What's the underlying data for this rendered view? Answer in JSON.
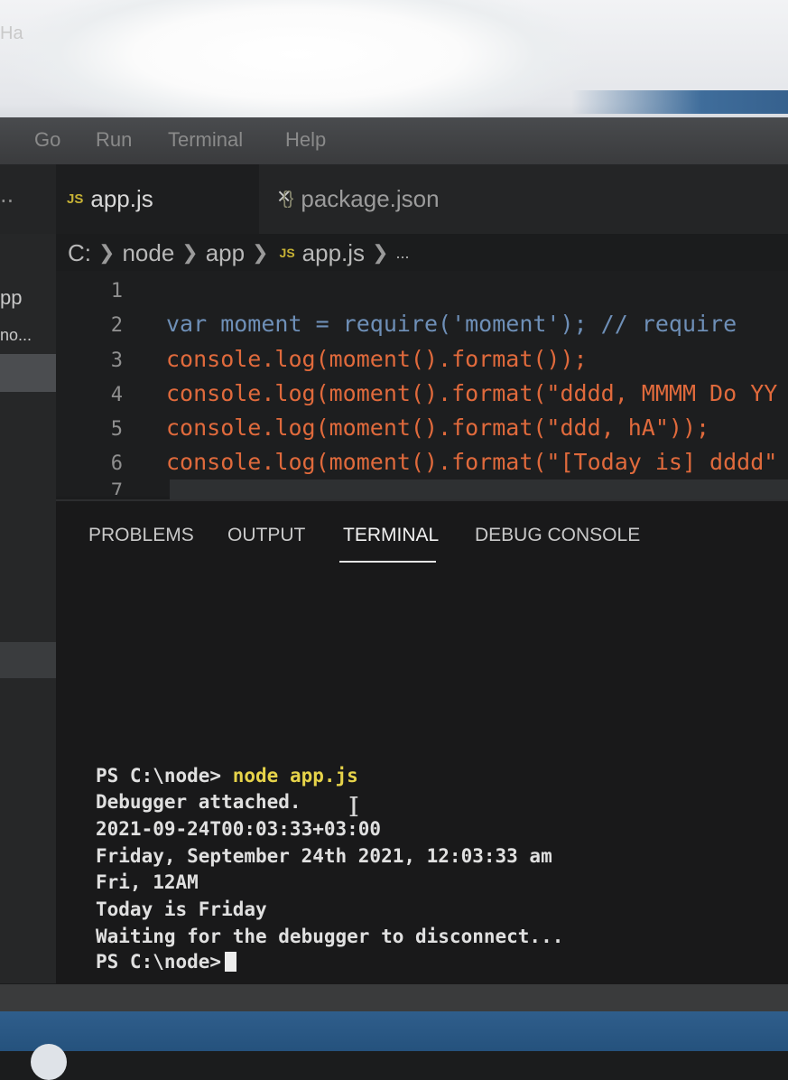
{
  "window": {
    "title_fragment": "Ha"
  },
  "menu": {
    "items": [
      "Go",
      "Run",
      "Terminal",
      "Help"
    ]
  },
  "tabs": [
    {
      "badge": "JS",
      "label": "app.js",
      "close": "×"
    },
    {
      "icon": "{}",
      "label": "package.json"
    }
  ],
  "tab_overflow": "..",
  "breadcrumb": {
    "drive": "C:",
    "parts": [
      "node",
      "app"
    ],
    "file_badge": "JS",
    "file": "app.js",
    "more": "..."
  },
  "sidebar": {
    "item1": "pp",
    "item2": "no..."
  },
  "editor": {
    "line_numbers": [
      "1",
      "2",
      "3",
      "4",
      "5",
      "6",
      "7"
    ],
    "lines": [
      "",
      "var moment = require('moment'); // require",
      "console.log(moment().format());",
      "console.log(moment().format(\"dddd, MMMM Do YY",
      "console.log(moment().format(\"ddd, hA\"));",
      "console.log(moment().format(\"[Today is] dddd\""
    ]
  },
  "panel": {
    "tabs": [
      "PROBLEMS",
      "OUTPUT",
      "TERMINAL",
      "DEBUG CONSOLE"
    ],
    "active_tab": "TERMINAL"
  },
  "terminal": {
    "prompt": "PS C:\\node>",
    "command": "node app.js",
    "output": [
      "Debugger attached.",
      "2021-09-24T00:03:33+03:00",
      "Friday, September 24th 2021, 12:03:33 am",
      "Fri, 12AM",
      "Today is Friday",
      "Waiting for the debugger to disconnect..."
    ],
    "final_prompt": "PS C:\\node>"
  },
  "colors": {
    "js_badge": "#c7b235",
    "command_highlight": "#e6d34a",
    "taskbar": "#2f5e8c"
  }
}
